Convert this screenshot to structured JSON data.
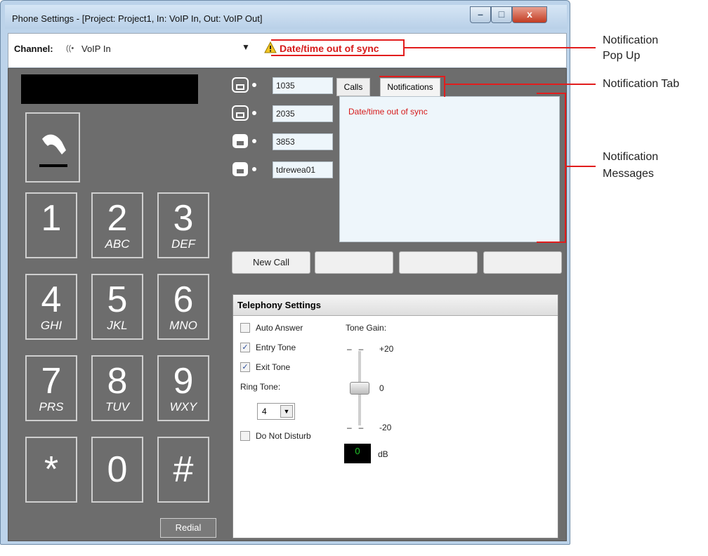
{
  "window": {
    "title": "Phone Settings - [Project: Project1, In: VoIP In, Out: VoIP Out]",
    "caption_buttons": {
      "minimize": "–",
      "maximize": "□",
      "close": "x"
    }
  },
  "channel": {
    "label": "Channel:",
    "value": "VoIP In",
    "icon": "audio-stream-icon",
    "warning_icon": "warning-triangle-icon",
    "warning_text": "Date/time out of sync"
  },
  "keypad": {
    "keys": [
      {
        "digit": "1",
        "letters": ""
      },
      {
        "digit": "2",
        "letters": "ABC"
      },
      {
        "digit": "3",
        "letters": "DEF"
      },
      {
        "digit": "4",
        "letters": "GHI"
      },
      {
        "digit": "5",
        "letters": "JKL"
      },
      {
        "digit": "6",
        "letters": "MNO"
      },
      {
        "digit": "7",
        "letters": "PRS"
      },
      {
        "digit": "8",
        "letters": "TUV"
      },
      {
        "digit": "9",
        "letters": "WXY"
      },
      {
        "digit": "*",
        "letters": ""
      },
      {
        "digit": "0",
        "letters": ""
      },
      {
        "digit": "#",
        "letters": ""
      }
    ],
    "redial_label": "Redial",
    "hook_icon": "handset-off-hook-icon"
  },
  "lines": [
    {
      "number": "1035",
      "state": "idle"
    },
    {
      "number": "2035",
      "state": "idle"
    },
    {
      "number": "3853",
      "state": "active"
    },
    {
      "number": "tdrewea01",
      "state": "active"
    }
  ],
  "tabs": {
    "calls": "Calls",
    "notifications": "Notifications",
    "active": "notifications"
  },
  "notifications": {
    "messages": [
      "Date/time out of sync"
    ]
  },
  "actions": {
    "new_call": "New Call",
    "blank1": "",
    "blank2": "",
    "blank3": ""
  },
  "telephony": {
    "title": "Telephony Settings",
    "auto_answer": {
      "label": "Auto Answer",
      "checked": false
    },
    "entry_tone": {
      "label": "Entry Tone",
      "checked": true
    },
    "exit_tone": {
      "label": "Exit Tone",
      "checked": true
    },
    "ring_tone_label": "Ring Tone:",
    "ring_tone_value": "4",
    "do_not_disturb": {
      "label": "Do Not Disturb",
      "checked": false
    },
    "tone_gain_label": "Tone Gain:",
    "gain_max": "+20",
    "gain_mid": "0",
    "gain_min": "-20",
    "gain_value": "0",
    "gain_unit": "dB"
  },
  "annotations": {
    "popup": "Notification\nPop Up",
    "popup_line1": "Notification",
    "popup_line2": "Pop Up",
    "tab": "Notification Tab",
    "messages_line1": "Notification",
    "messages_line2": "Messages"
  },
  "colors": {
    "warning_red": "#d61a1a",
    "panel_grey": "#6d6d6d",
    "annotation_red": "#e21d1d"
  }
}
